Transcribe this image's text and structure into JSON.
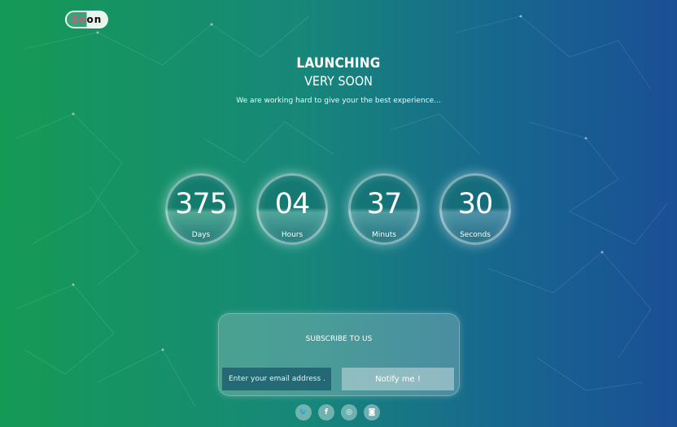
{
  "brand": {
    "logo_text": "Soon"
  },
  "hero": {
    "title_line1": "LAUNCHING",
    "title_line2": "VERY SOON",
    "subtitle": "We are working hard to give your the best experience..."
  },
  "countdown": [
    {
      "value": "375",
      "label": "Days"
    },
    {
      "value": "04",
      "label": "Hours"
    },
    {
      "value": "37",
      "label": "Minuts"
    },
    {
      "value": "30",
      "label": "Seconds"
    }
  ],
  "subscribe": {
    "title": "SUBSCRIBE TO US",
    "email_placeholder": "Enter your email address ...",
    "button_label": "Notify me !"
  },
  "social": [
    {
      "icon": "twitter-icon",
      "glyph": "🐦"
    },
    {
      "icon": "facebook-icon",
      "glyph": "f"
    },
    {
      "icon": "dribbble-icon",
      "glyph": "◎"
    },
    {
      "icon": "instagram-icon",
      "glyph": "◙"
    }
  ],
  "colors": {
    "gradient_left": "#159a55",
    "gradient_right": "#1a4f96"
  }
}
